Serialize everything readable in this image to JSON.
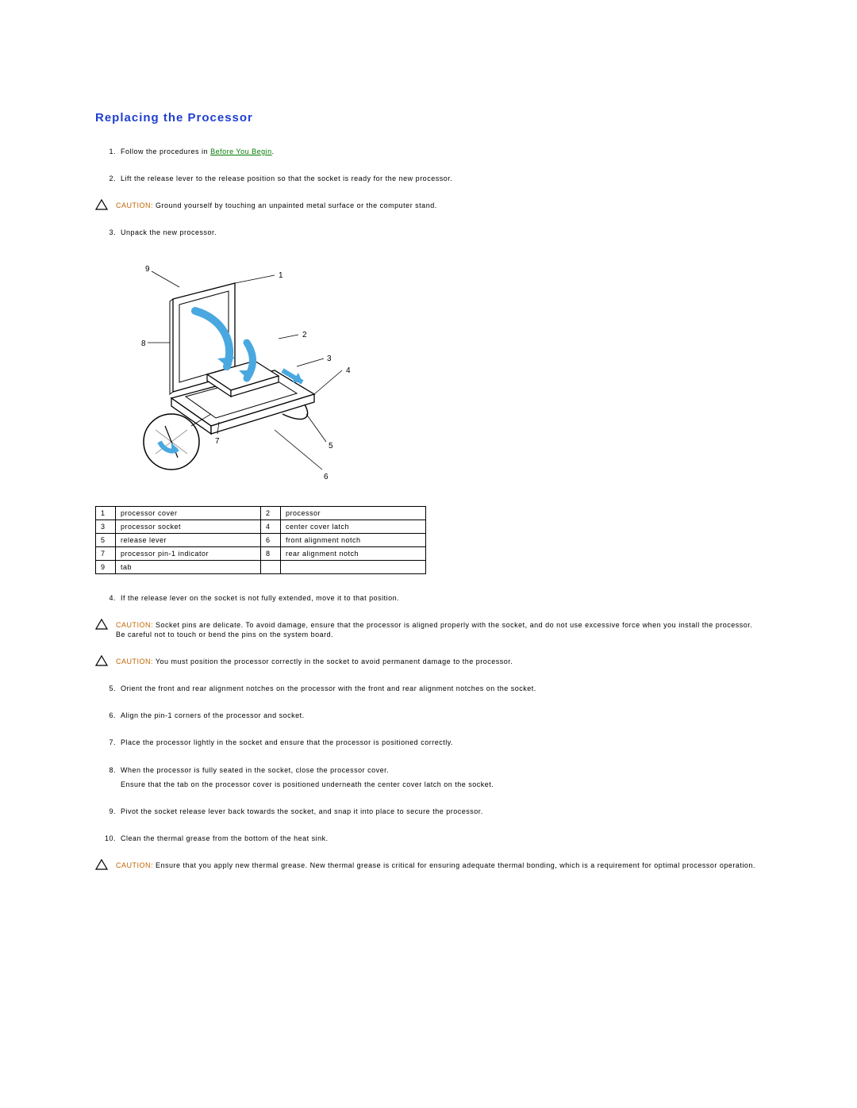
{
  "title": "Replacing the Processor",
  "steps": {
    "s1_num": "1.",
    "s1_a": "Follow the procedures in ",
    "s1_link": "Before You Begin",
    "s1_b": ".",
    "s2_num": "2.",
    "s2": "Lift the release lever to the release position so that the socket is ready for the new processor.",
    "s3_num": "3.",
    "s3": "Unpack the new processor.",
    "s4_num": "4.",
    "s4": "If the release lever on the socket is not fully extended, move it to that position.",
    "s5_num": "5.",
    "s5": "Orient the front and rear alignment notches on the processor with the front and rear alignment notches on the socket.",
    "s6_num": "6.",
    "s6": "Align the pin-1 corners of the processor and socket.",
    "s7_num": "7.",
    "s7": "Place the processor lightly in the socket and ensure that the processor is positioned correctly.",
    "s8_num": "8.",
    "s8": "When the processor is fully seated in the socket, close the processor cover.",
    "s8b": "Ensure that the tab on the processor cover is positioned underneath the center cover latch on the socket.",
    "s9_num": "9.",
    "s9": "Pivot the socket release lever back towards the socket, and snap it into place to secure the processor.",
    "s10_num": "10.",
    "s10": "Clean the thermal grease from the bottom of the heat sink."
  },
  "caution_label": "CAUTION: ",
  "cautions": {
    "c1": "Ground yourself by touching an unpainted metal surface or the computer stand.",
    "c2": "Socket pins are delicate. To avoid damage, ensure that the processor is aligned properly with the socket, and do not use excessive force when you install the processor. Be careful not to touch or bend the pins on the system board.",
    "c3": "You must position the processor correctly in the socket to avoid permanent damage to the processor.",
    "c4": "Ensure that you apply new thermal grease. New thermal grease is critical for ensuring adequate thermal bonding, which is a requirement for optimal processor operation."
  },
  "parts": {
    "r1a_n": "1",
    "r1a_l": "processor cover",
    "r1b_n": "2",
    "r1b_l": "processor",
    "r2a_n": "3",
    "r2a_l": "processor socket",
    "r2b_n": "4",
    "r2b_l": "center cover latch",
    "r3a_n": "5",
    "r3a_l": "release lever",
    "r3b_n": "6",
    "r3b_l": "front alignment notch",
    "r4a_n": "7",
    "r4a_l": "processor pin-1 indicator",
    "r4b_n": "8",
    "r4b_l": "rear alignment notch",
    "r5a_n": "9",
    "r5a_l": "tab",
    "r5b_n": "",
    "r5b_l": ""
  },
  "callouts": {
    "c1": "1",
    "c2": "2",
    "c3": "3",
    "c4": "4",
    "c5": "5",
    "c6": "6",
    "c7": "7",
    "c8": "8",
    "c9": "9"
  }
}
